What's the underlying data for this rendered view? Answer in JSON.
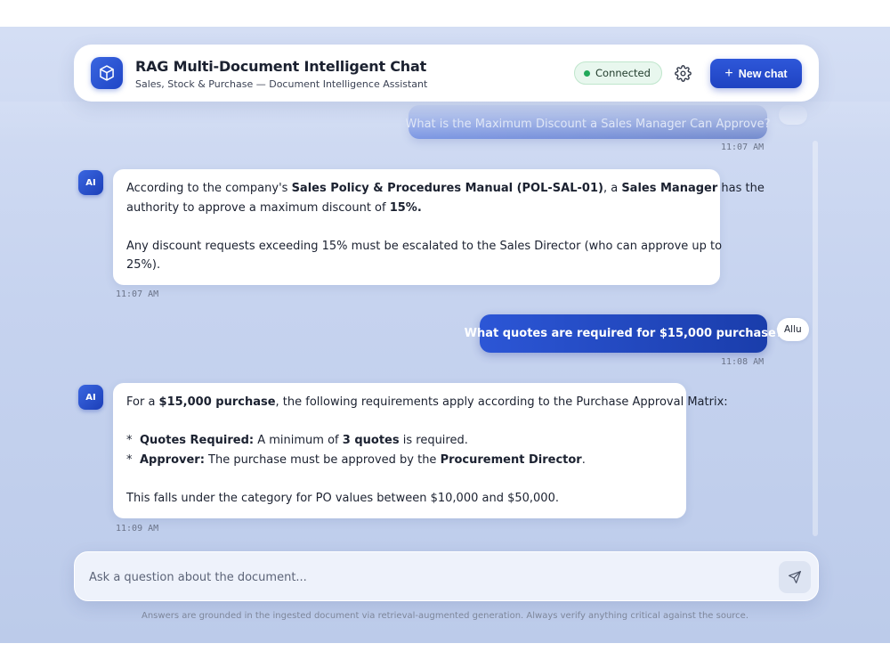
{
  "header": {
    "title": "RAG Multi-Document Intelligent Chat",
    "subtitle": "Sales, Stock & Purchase — Document Intelligence Assistant",
    "status": "Connected",
    "new_chat_label": "New chat"
  },
  "messages": {
    "prev_user_question": "What is the Maximum Discount a Sales Manager Can Approve?",
    "prev_user_time": "11:07 AM",
    "ai_badge": "AI",
    "user_name": "Allu",
    "ai1": {
      "l1_a": "According to the company's ",
      "l1_b": "Sales Policy & Procedures Manual (POL-SAL-01)",
      "l1_c": ", a ",
      "l1_d": "Sales Manager",
      "l1_e": " has the",
      "l2_a": "authority to approve a maximum discount of ",
      "l2_b": "15%.",
      "l3": "Any discount requests exceeding 15% must be escalated to the Sales Director (who can approve up to",
      "l4": "25%).",
      "time": "11:07 AM"
    },
    "user2": {
      "text": "What quotes are required for $15,000 purchase?",
      "time": "11:08 AM"
    },
    "ai2": {
      "l1_a": "For a ",
      "l1_b": "$15,000 purchase",
      "l1_c": ", the following requirements apply according to the Purchase Approval Matrix:",
      "b1_label": "Quotes Required:",
      "b1_a": " A minimum of ",
      "b1_b": "3 quotes",
      "b1_c": " is required.",
      "b2_label": "Approver:",
      "b2_a": " The purchase must be approved by the ",
      "b2_b": "Procurement Director",
      "b2_c": ".",
      "bullet": "*",
      "l_end": "This falls under the category for PO values between $10,000 and $50,000.",
      "time": "11:09 AM"
    }
  },
  "input": {
    "placeholder": "Ask a question about the document..."
  },
  "footer": {
    "note": "Answers are grounded in the ingested document via retrieval-augmented generation. Always verify anything critical against the source."
  },
  "colors": {
    "accent": "#1f45c6",
    "status_dot": "#22a95a"
  }
}
